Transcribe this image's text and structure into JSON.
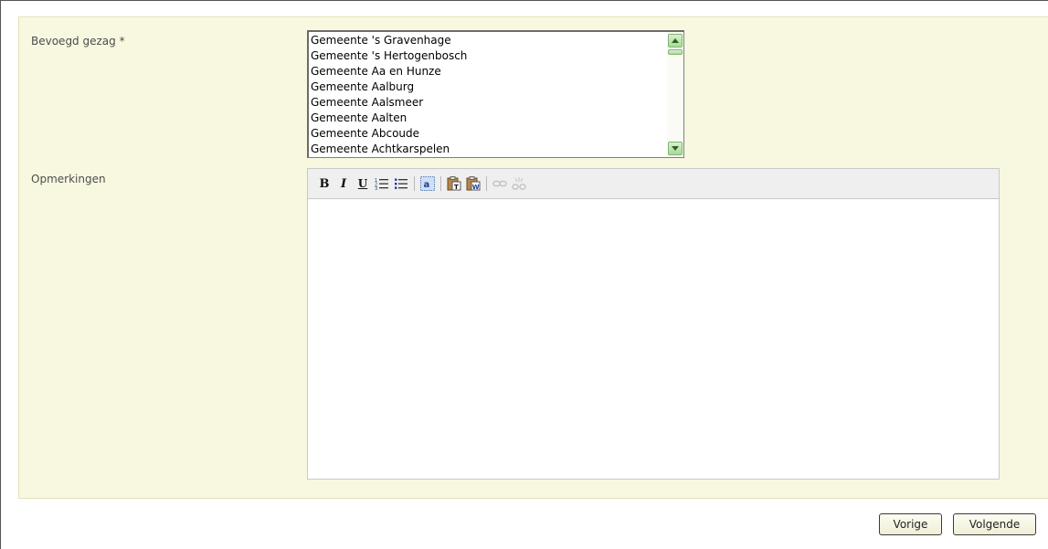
{
  "form": {
    "authority_label": "Bevoegd gezag *",
    "remarks_label": "Opmerkingen",
    "authority_options": [
      "Gemeente 's Gravenhage",
      "Gemeente 's Hertogenbosch",
      "Gemeente Aa en Hunze",
      "Gemeente Aalburg",
      "Gemeente Aalsmeer",
      "Gemeente Aalten",
      "Gemeente Abcoude",
      "Gemeente Achtkarspelen"
    ],
    "remarks_value": ""
  },
  "toolbar": {
    "bold_glyph": "B",
    "italic_glyph": "I",
    "underline_glyph": "U",
    "icons": [
      "bold-icon",
      "italic-icon",
      "underline-icon",
      "ordered-list-icon",
      "unordered-list-icon",
      "select-all-icon",
      "paste-text-icon",
      "paste-word-icon",
      "link-icon",
      "unlink-icon"
    ]
  },
  "nav": {
    "prev_label": "Vorige",
    "next_label": "Volgende"
  },
  "colors": {
    "panel_bg": "#f8f8e1",
    "scroll_accent": "#a9d99b"
  }
}
